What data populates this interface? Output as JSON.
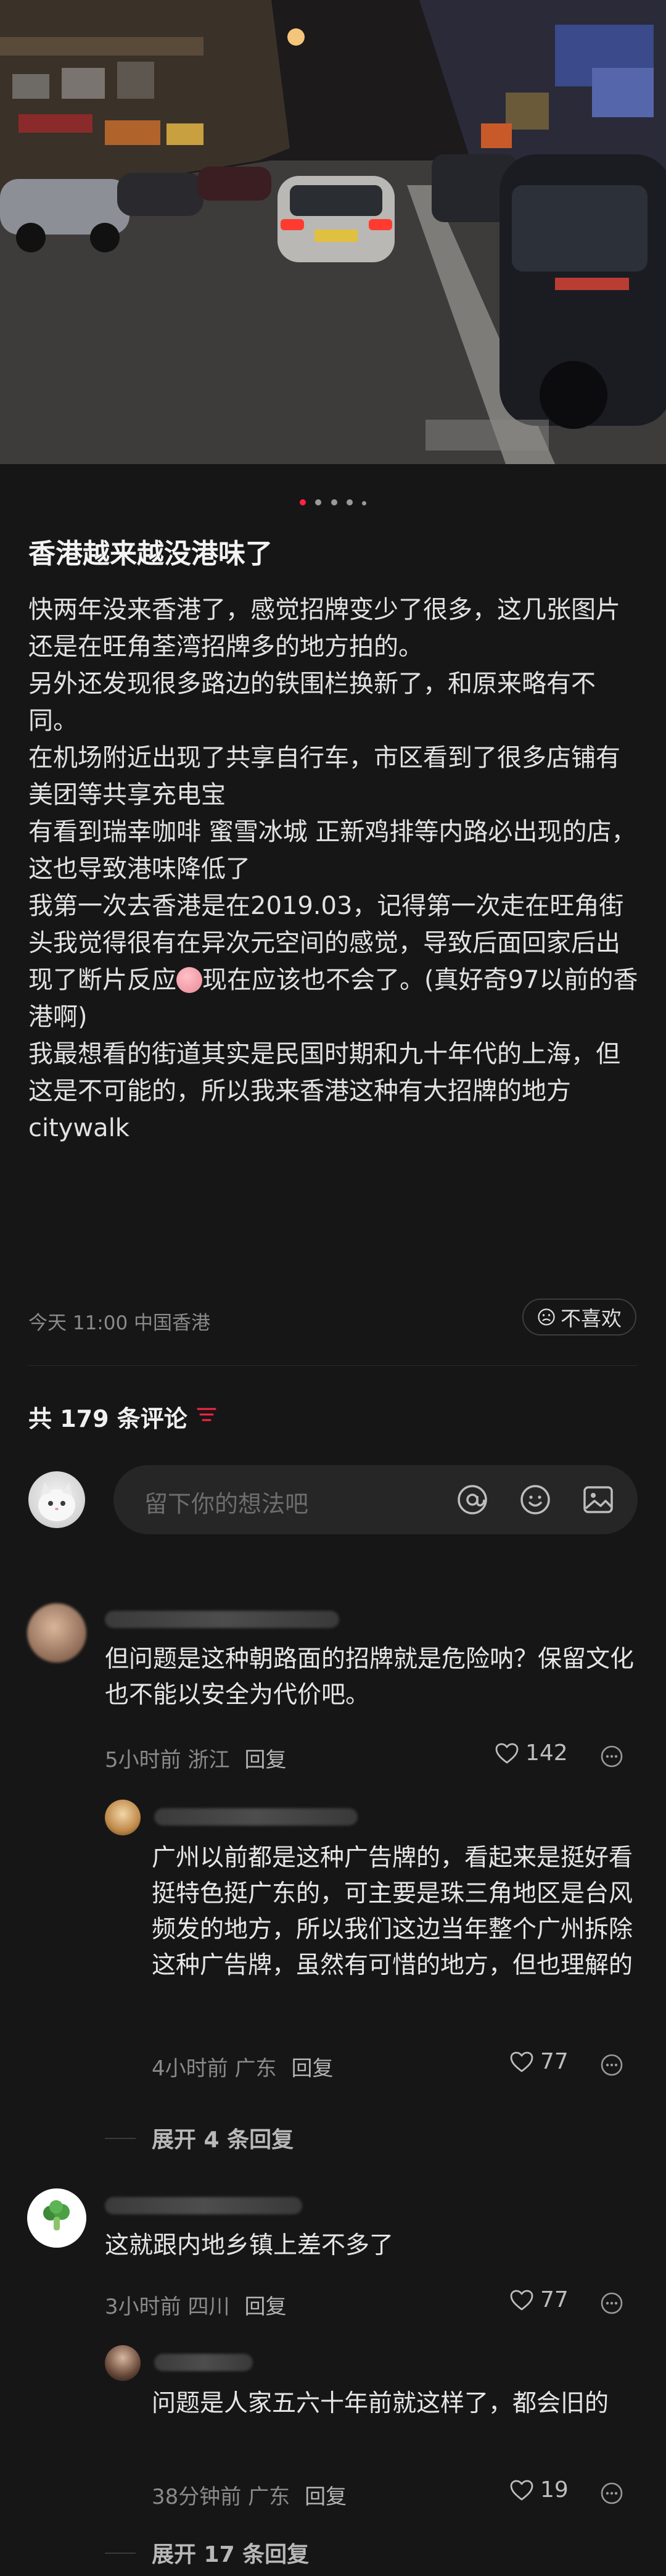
{
  "post": {
    "title": "香港越来越没港味了",
    "paragraphs": [
      "快两年没来香港了，感觉招牌变少了很多，这几张图片还是在旺角荃湾招牌多的地方拍的。",
      "另外还发现很多路边的铁围栏换新了，和原来略有不同。",
      "在机场附近出现了共享自行车，市区看到了很多店铺有美团等共享充电宝",
      "有看到瑞幸咖啡 蜜雪冰城 正新鸡排等内路必出现的店，这也导致港味降低了"
    ],
    "paragraph5_before_emoji": "我第一次去香港是在2019.03，记得第一次走在旺角街头我觉得很有在异次元空间的感觉，导致后面回家后出现了断片反应",
    "paragraph5_after_emoji": "现在应该也不会了。(真好奇97以前的香港啊)",
    "paragraph6": "我最想看的街道其实是民国时期和九十年代的上海，但这是不可能的，所以我来香港这种有大招牌的地方citywalk",
    "meta": "今天 11:00 中国香港",
    "dislike_label": "不喜欢",
    "carousel": {
      "count": 5,
      "active_index": 0
    }
  },
  "comments_header": {
    "count_label": "共 179 条评论"
  },
  "composer": {
    "placeholder": "留下你的想法吧",
    "icons": [
      "at-icon",
      "emoji-icon",
      "image-icon"
    ]
  },
  "comments": [
    {
      "text": "但问题是这种朝路面的招牌就是危险呐？保留文化也不能以安全为代价吧。",
      "time_location": "5小时前 浙江",
      "reply_label": "回复",
      "likes": "142"
    },
    {
      "text": "广州以前都是这种广告牌的，看起来是挺好看挺特色挺广东的，可主要是珠三角地区是台风频发的地方，所以我们这边当年整个广州拆除这种广告牌，虽然有可惜的地方，但也理解的",
      "time_location": "4小时前 广东",
      "reply_label": "回复",
      "likes": "77",
      "expand_label": "展开 4 条回复"
    },
    {
      "text": "这就跟内地乡镇上差不多了",
      "time_location": "3小时前 四川",
      "reply_label": "回复",
      "likes": "77"
    },
    {
      "text": "问题是人家五六十年前就这样了，都会旧的",
      "time_location": "38分钟前 广东",
      "reply_label": "回复",
      "likes": "19",
      "expand_label": "展开 17 条回复"
    }
  ],
  "colors": {
    "background": "#161616",
    "accent": "#ff2442",
    "muted": "#8a8a8a"
  }
}
